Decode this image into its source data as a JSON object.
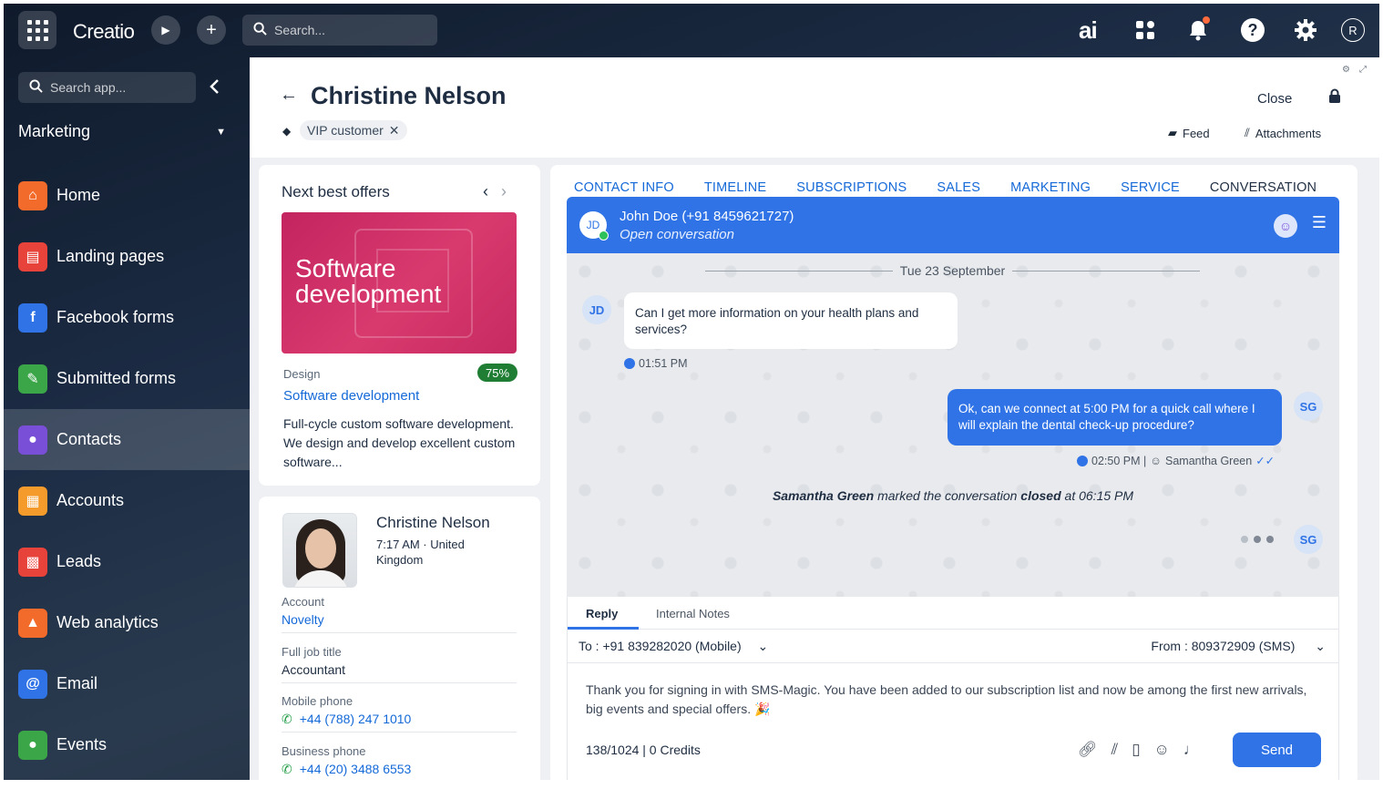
{
  "topbar": {
    "logo": "Creatio",
    "run_icon": "▶",
    "add_icon": "+",
    "search_placeholder": "Search...",
    "ai_label": "ai",
    "help_label": "?",
    "user_initial": "R"
  },
  "sidebar": {
    "search_placeholder": "Search app...",
    "workspace": "Marketing",
    "items": [
      {
        "label": "Home",
        "icon": "home-icon",
        "color": "#f26b2b",
        "glyph": "⌂"
      },
      {
        "label": "Landing pages",
        "icon": "landing-pages-icon",
        "color": "#e8433a",
        "glyph": "▤"
      },
      {
        "label": "Facebook forms",
        "icon": "facebook-icon",
        "color": "#2f73e6",
        "glyph": "f"
      },
      {
        "label": "Submitted forms",
        "icon": "submitted-forms-icon",
        "color": "#3aa648",
        "glyph": "✎"
      },
      {
        "label": "Contacts",
        "icon": "contacts-icon",
        "color": "#7a4fd8",
        "glyph": "●"
      },
      {
        "label": "Accounts",
        "icon": "accounts-icon",
        "color": "#f59b2b",
        "glyph": "▦"
      },
      {
        "label": "Leads",
        "icon": "leads-icon",
        "color": "#e8433a",
        "glyph": "▩"
      },
      {
        "label": "Web analytics",
        "icon": "web-analytics-icon",
        "color": "#f26b2b",
        "glyph": "▲"
      },
      {
        "label": "Email",
        "icon": "email-icon",
        "color": "#2f73e6",
        "glyph": "@"
      },
      {
        "label": "Events",
        "icon": "events-icon",
        "color": "#3aa648",
        "glyph": "●"
      }
    ],
    "active": "Contacts"
  },
  "record": {
    "title": "Christine Nelson",
    "tag": "VIP customer",
    "close_label": "Close",
    "feed_label": "Feed",
    "attachments_label": "Attachments"
  },
  "offers": {
    "title": "Next best offers",
    "image_text": "Software development",
    "category": "Design",
    "score": "75%",
    "name": "Software development",
    "description": "Full-cycle custom software development. We design and develop excellent custom software..."
  },
  "profile": {
    "name": "Christine Nelson",
    "time_location": "7:17 AM · United Kingdom",
    "fields": [
      {
        "label": "Account",
        "value": "Novelty",
        "link": true
      },
      {
        "label": "Full job title",
        "value": "Accountant",
        "link": false
      },
      {
        "label": "Mobile phone",
        "value": "+44 (788) 247 1010",
        "link": true
      },
      {
        "label": "Business phone",
        "value": "+44 (20) 3488 6553",
        "link": true
      }
    ]
  },
  "tabs": [
    "CONTACT INFO",
    "TIMELINE",
    "SUBSCRIPTIONS",
    "SALES",
    "MARKETING",
    "SERVICE",
    "CONVERSATION"
  ],
  "conversation": {
    "contact_initials": "JD",
    "contact_name": "John Doe (+91 8459621727)",
    "status": "Open conversation",
    "date": "Tue 23 September",
    "incoming_text": "Can I get more information on your health plans and services?",
    "incoming_time": "01:51 PM",
    "outgoing_text": "Ok, can we connect at 5:00 PM for a quick call where I will explain the dental check-up procedure?",
    "outgoing_meta": "02:50 PM | ",
    "agent_name": "Samantha Green",
    "agent_initials": "SG",
    "system_actor": "Samantha Green",
    "system_mid": " marked the conversation ",
    "system_state": "closed",
    "system_end": " at 06:15 PM"
  },
  "reply": {
    "tab_reply": "Reply",
    "tab_notes": "Internal Notes",
    "to": "To : +91 839282020 (Mobile)",
    "from": "From : 809372909 (SMS)",
    "message": "Thank you for signing in with SMS-Magic. You have been added to our subscription list and now be among the first new arrivals, big events and special offers. 🎉",
    "counter": "138/1024 | 0 Credits",
    "send_label": "Send"
  }
}
